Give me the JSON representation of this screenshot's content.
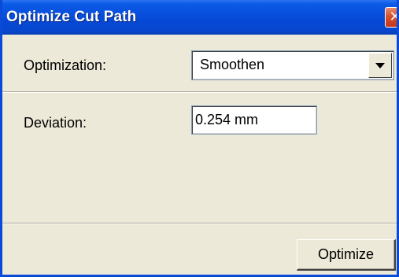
{
  "window": {
    "title": "Optimize Cut Path",
    "close_symbol": "✕"
  },
  "optimization": {
    "label": "Optimization:",
    "selected": "Smoothen"
  },
  "deviation": {
    "label": "Deviation:",
    "value": "0.254 mm"
  },
  "actions": {
    "optimize_label": "Optimize"
  },
  "colors": {
    "titlebar": "#0648D6",
    "window_bg": "#ECE9D8",
    "close_button": "#D9512A"
  }
}
